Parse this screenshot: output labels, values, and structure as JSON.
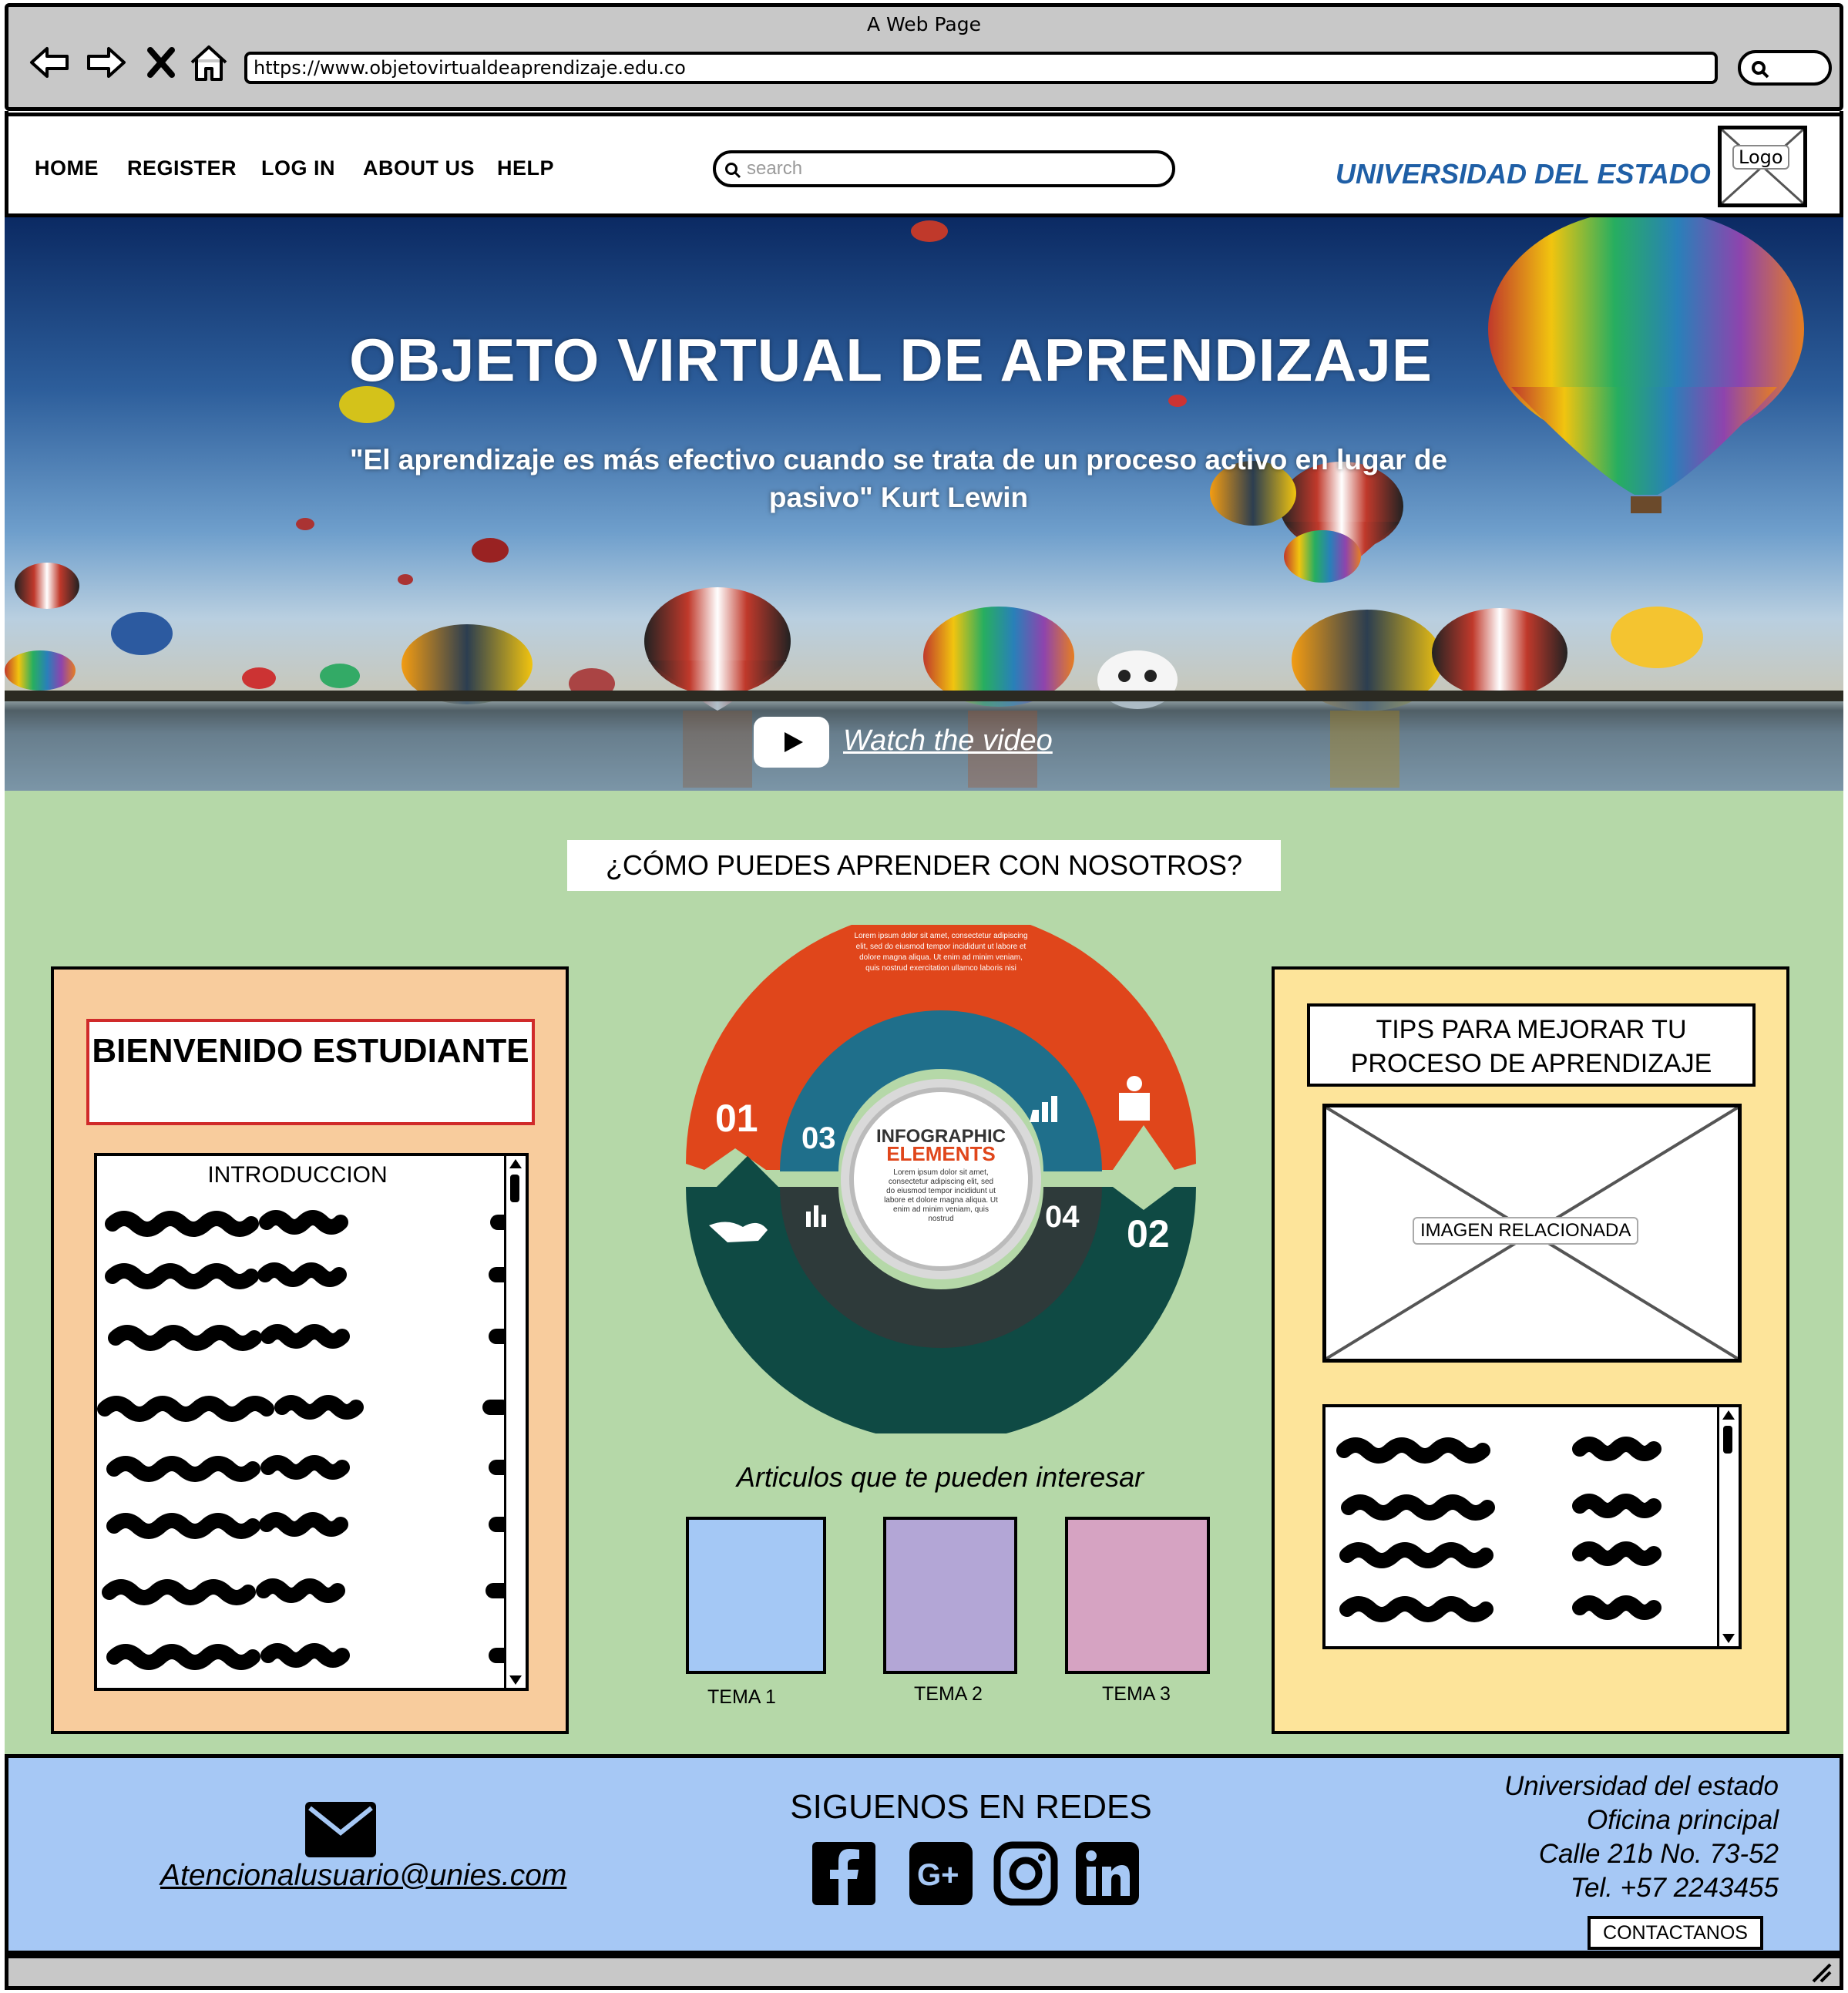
{
  "browser": {
    "window_title": "A Web Page",
    "url": "https://www.objetovirtualdeaprendizaje.edu.co",
    "icons": [
      "back-arrow-icon",
      "forward-arrow-icon",
      "close-x-icon",
      "home-icon",
      "search-icon"
    ]
  },
  "header": {
    "nav": [
      "HOME",
      "REGISTER",
      "LOG IN",
      "ABOUT US",
      "HELP"
    ],
    "search_placeholder": "search",
    "university": "UNIVERSIDAD DEL ESTADO",
    "logo_label": "Logo"
  },
  "hero": {
    "title": "OBJETO VIRTUAL DE APRENDIZAJE",
    "quote": "\"El aprendizaje es más efectivo cuando se trata de un proceso activo en lugar de pasivo\" Kurt Lewin",
    "video_link": "Watch the video"
  },
  "main": {
    "section_title": "¿CÓMO PUEDES APRENDER CON NOSOTROS?",
    "welcome": "BIENVENIDO ESTUDIANTE",
    "intro_title": "INTRODUCCION",
    "tips_title": "TIPS PARA MEJORAR TU PROCESO DE APRENDIZAJE",
    "image_label": "IMAGEN RELACIONADA",
    "infographic": {
      "title_line1": "INFOGRAPHIC",
      "title_line2": "ELEMENTS",
      "numbers": [
        "01",
        "02",
        "03",
        "04"
      ],
      "center_text": "Lorem ipsum dolor sit amet, consectetur adipiscing elit, sed do eiusmod tempor incididunt ut labore et dolore magna aliqua. Ut enim ad minim veniam, quis nostrud",
      "top_text": "Lorem ipsum dolor sit amet, consectetur adipiscing elit, sed do eiusmod tempor incididunt ut labore et dolore magna aliqua. Ut enim ad minim veniam, quis nostrud exercitation ullamco laboris nisi"
    },
    "articles_title": "Articulos que te pueden interesar",
    "articles": [
      {
        "label": "TEMA 1",
        "color": "#a4c8f5"
      },
      {
        "label": "TEMA 2",
        "color": "#b3a6d6"
      },
      {
        "label": "TEMA 3",
        "color": "#d6a3c2"
      }
    ],
    "colors": {
      "green_bg": "#b5d8a8",
      "left_panel": "#f8cc9d",
      "right_panel": "#fde49a",
      "accent_red": "#d02a2a",
      "univ_blue": "#1f5fa6"
    }
  },
  "footer": {
    "email": "Atencionalusuario@unies.com",
    "social_title": "SIGUENOS EN REDES",
    "social_icons": [
      "facebook-icon",
      "google-plus-icon",
      "instagram-icon",
      "linkedin-icon"
    ],
    "address": [
      "Universidad del estado",
      "Oficina principal",
      "Calle 21b No. 73-52",
      "Tel. +57 2243455"
    ],
    "contact_button": "CONTACTANOS",
    "bg": "#a6c8f5"
  }
}
